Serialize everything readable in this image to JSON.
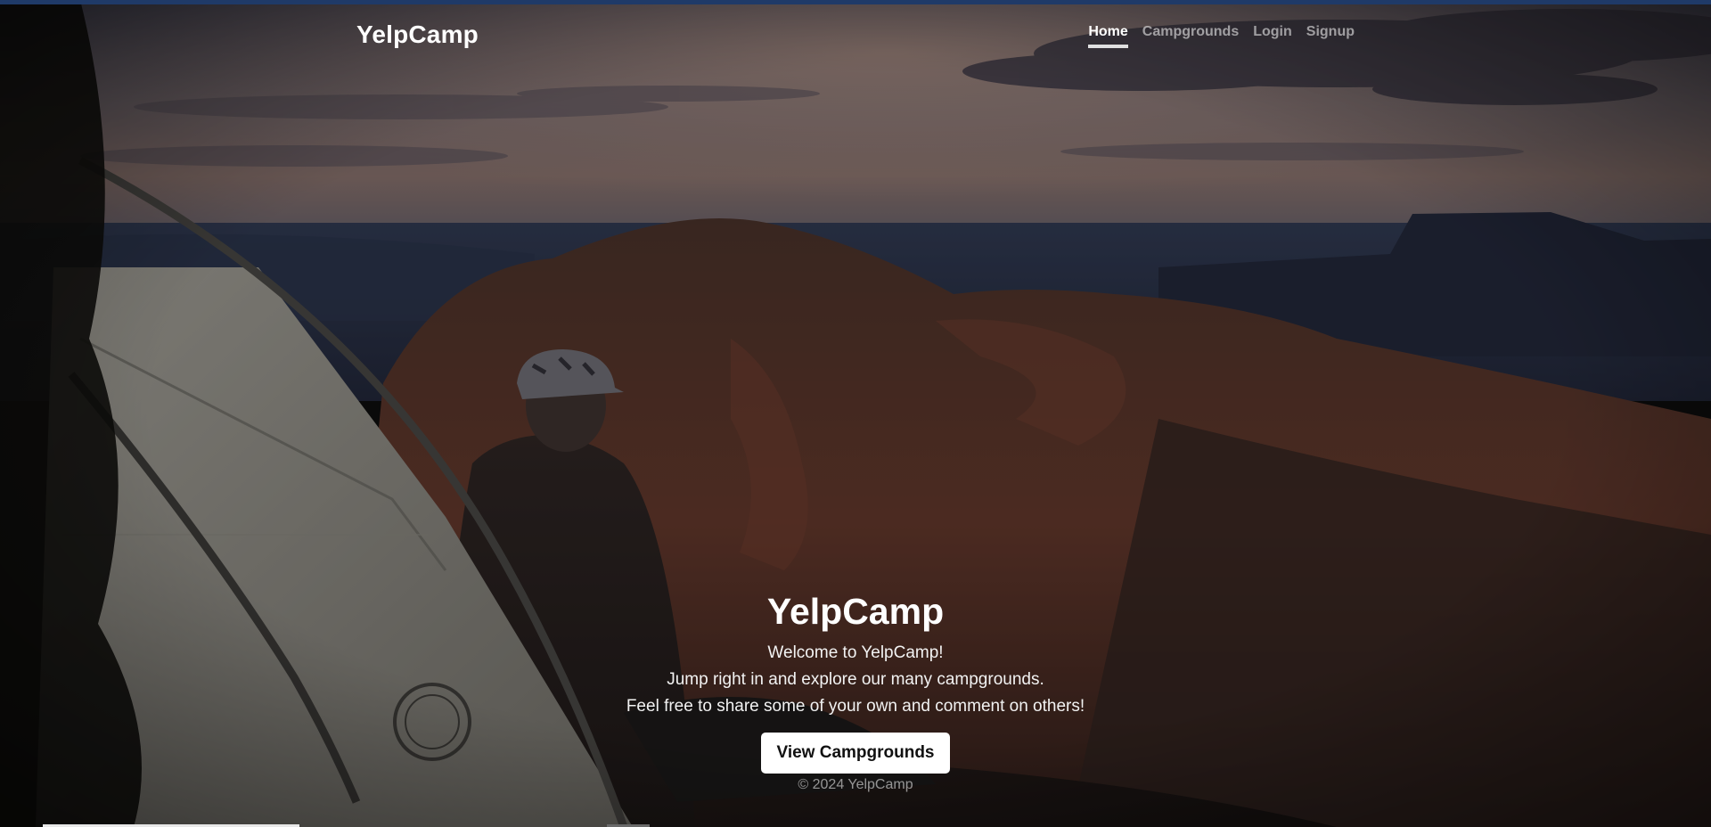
{
  "navbar": {
    "brand": "YelpCamp",
    "links": [
      {
        "label": "Home",
        "active": true
      },
      {
        "label": "Campgrounds",
        "active": false
      },
      {
        "label": "Login",
        "active": false
      },
      {
        "label": "Signup",
        "active": false
      }
    ]
  },
  "hero": {
    "title": "YelpCamp",
    "lines": [
      "Welcome to YelpCamp!",
      "Jump right in and explore our many campgrounds.",
      "Feel free to share some of your own and comment on others!"
    ],
    "cta_label": "View Campgrounds"
  },
  "footer": {
    "text": "© 2024 YelpCamp"
  },
  "colors": {
    "overlay": "#000000",
    "nav_active": "#ffffff",
    "nav_inactive": "#8c8c8c",
    "button_bg": "#ffffff",
    "button_text": "#111111",
    "window_strip": "#1f3a68"
  }
}
